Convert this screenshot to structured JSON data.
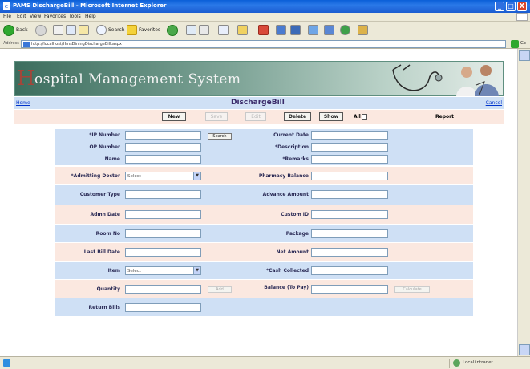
{
  "window": {
    "title": "PAMS DischargeBill - Microsoft Internet Explorer",
    "min": "_",
    "max": "□",
    "close": "X"
  },
  "menu": [
    "File",
    "Edit",
    "View",
    "Favorites",
    "Tools",
    "Help"
  ],
  "toolbar": {
    "back": "Back",
    "search": "Search",
    "favorites": "Favorites"
  },
  "address": {
    "label": "Address",
    "url": "http://localhost/HmsDiningDischargeBill.aspx",
    "go": "Go"
  },
  "banner": {
    "title_h": "H",
    "title_rest": "ospital  Management  System"
  },
  "nav": {
    "home": "Home",
    "page_title": "DischargeBill",
    "cancel": "Cancel"
  },
  "buttons": {
    "new": "New",
    "save": "Save",
    "edit": "Edit",
    "delete": "Delete",
    "show": "Show",
    "all": "All",
    "report": "Report",
    "search": "Search",
    "calculate": "Calculate",
    "add": "Add"
  },
  "form": {
    "left": {
      "ip_number": "*IP Number",
      "op_number": "OP Number",
      "name": "Name",
      "admitting_doctor": "*Admitting Doctor",
      "admitting_doctor_value": "Select",
      "customer_type": "Customer Type",
      "admin_date": "Admn Date",
      "room_no": "Room No",
      "last_bill_date": "Last Bill Date",
      "item": "Item",
      "item_value": "Select",
      "quantity": "Quantity",
      "return_bills": "Return Bills"
    },
    "right": {
      "current_date": "Current Date",
      "description": "*Description",
      "remarks": "*Remarks",
      "pharmacy_balance": "Pharmacy Balance",
      "advance_amount": "Advance Amount",
      "custom_id": "Custom ID",
      "package": "Package",
      "net_amount": "Net Amount",
      "cash_collected": "*Cash Collected",
      "balance_to_pay": "Balance (To Pay)"
    }
  },
  "status": {
    "zone": "Local intranet"
  },
  "colors": {
    "row_blue": "#cfe0f5",
    "row_pink": "#fbe8e0",
    "title_blue": "#0a5fd8"
  }
}
